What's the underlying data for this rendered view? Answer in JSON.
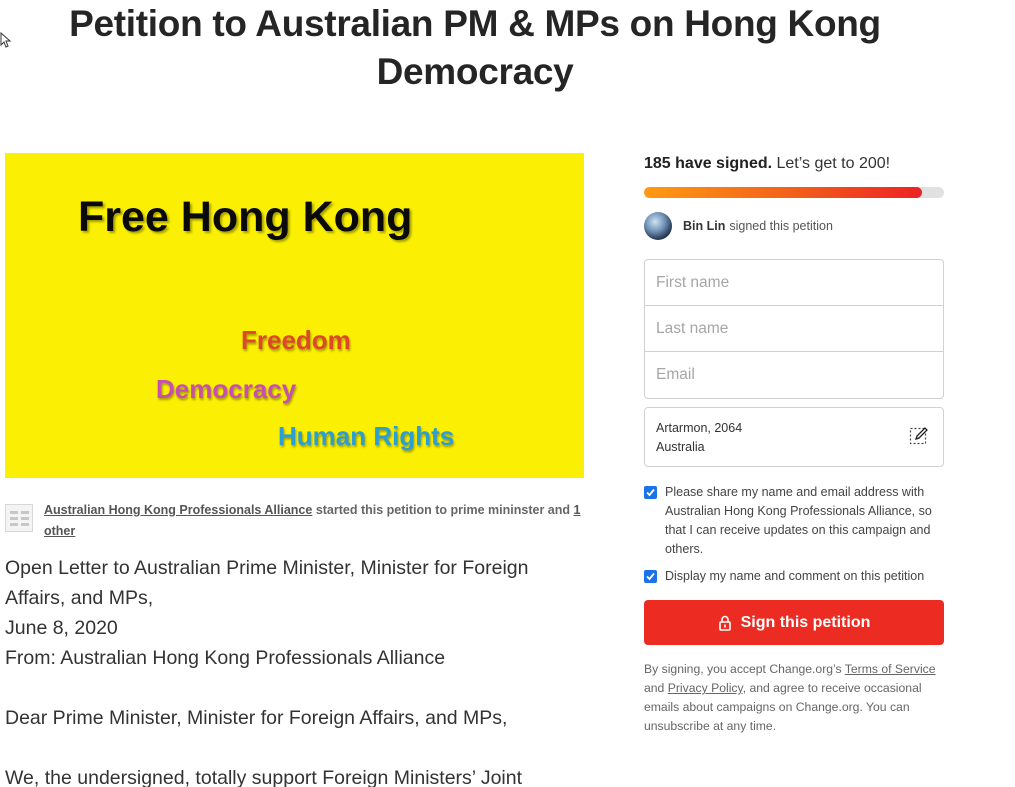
{
  "page": {
    "title": "Petition to Australian PM & MPs on Hong Kong Democracy"
  },
  "hero": {
    "title": "Free Hong Kong",
    "words": [
      "Freedom",
      "Democracy",
      "Human Rights"
    ]
  },
  "starter": {
    "org": "Australian Hong Kong Professionals Alliance",
    "middle": " started this petition to prime mininster and ",
    "other": "1 other"
  },
  "body": {
    "lines": [
      "Open Letter to Australian Prime Minister, Minister for Foreign Affairs, and MPs,",
      "June 8, 2020",
      "From: Australian Hong Kong Professionals Alliance",
      "Dear Prime Minister, Minister for Foreign Affairs, and MPs,",
      "We, the undersigned, totally support Foreign Ministers’ Joint"
    ]
  },
  "sidebar": {
    "count_bold": "185 have signed.",
    "count_rest": " Let’s get to 200!",
    "progress": 0.925,
    "progress_colors": [
      "#ff9a12",
      "#ec2224"
    ],
    "recent_name": "Bin Lin",
    "recent_action": "signed this petition",
    "fields": {
      "first_name_placeholder": "First name",
      "last_name_placeholder": "Last name",
      "email_placeholder": "Email"
    },
    "location_line1": "Artarmon, 2064",
    "location_line2": "Australia",
    "share_label": "Please share my name and email address with Australian Hong Kong Professionals Alliance, so that I can receive updates on this campaign and others.",
    "display_label": "Display my name and comment on this petition",
    "sign_button": "Sign this petition",
    "button_color": "#ec2c22",
    "legal": {
      "t1": "By signing, you accept Change.org’s ",
      "terms": "Terms of Service",
      "t2": " and ",
      "privacy": "Privacy Policy",
      "t3": ", and agree to receive occasional emails about campaigns on Change.org. You can unsubscribe at any time."
    }
  }
}
